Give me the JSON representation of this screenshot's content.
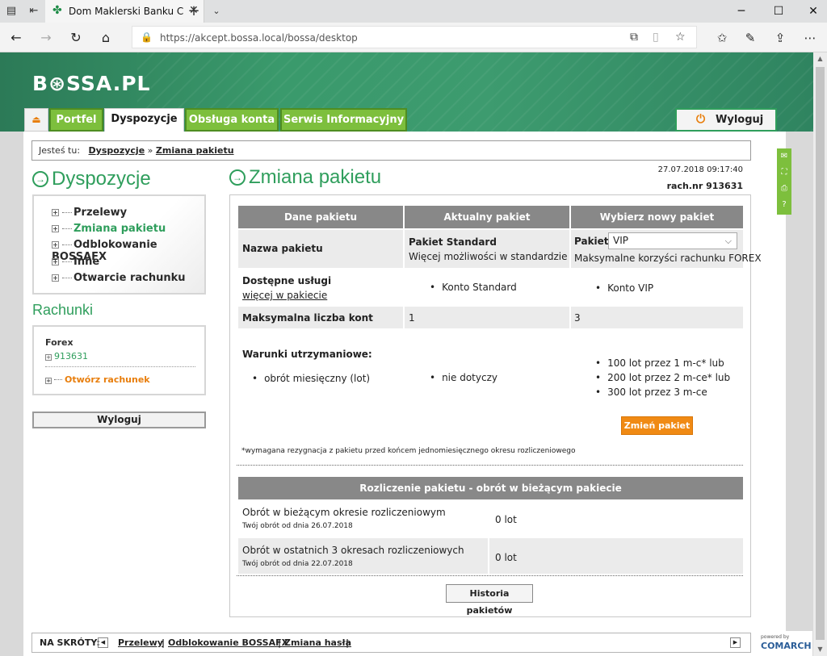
{
  "browser": {
    "tab_title": "Dom Maklerski Banku C",
    "url": "https://akcept.bossa.local/bossa/desktop"
  },
  "header": {
    "logo": "B⊛SSA.PL",
    "nav": [
      "Portfel",
      "Dyspozycje",
      "Obsługa konta",
      "Serwis Informacyjny"
    ],
    "active_nav": "Dyspozycje",
    "logout": "Wyloguj"
  },
  "breadcrumb": {
    "prefix": "Jesteś tu:",
    "items": [
      "Dyspozycje",
      "Zmiana pakietu"
    ],
    "sep": "»"
  },
  "sidebar": {
    "title": "Dyspozycje",
    "items": [
      {
        "label": "Przelewy",
        "active": false
      },
      {
        "label": "Zmiana pakietu",
        "active": true
      },
      {
        "label": "Odblokowanie BOSSAFX",
        "active": false
      },
      {
        "label": "Inne",
        "active": false
      },
      {
        "label": "Otwarcie rachunku",
        "active": false
      }
    ],
    "accounts_title": "Rachunki",
    "account_type": "Forex",
    "account_number": "913631",
    "open_account": "Otwórz rachunek",
    "logout": "Wyloguj"
  },
  "main": {
    "title": "Zmiana pakietu",
    "datetime": "27.07.2018 09:17:40",
    "account": "rach.nr 913631",
    "table": {
      "headers": [
        "Dane pakietu",
        "Aktualny pakiet",
        "Wybierz nowy pakiet"
      ],
      "package_name_label": "Nazwa pakietu",
      "current_name": "Pakiet Standard",
      "current_desc": "Więcej możliwości w standardzie",
      "new_label": "Pakiet",
      "new_selected": "VIP",
      "new_desc": "Maksymalne korzyści rachunku FOREX",
      "services_label": "Dostępne usługi",
      "services_link": "więcej w pakiecie",
      "current_service": "Konto Standard",
      "new_service": "Konto VIP",
      "max_accounts_label": "Maksymalna liczba kont",
      "current_max": "1",
      "new_max": "3",
      "conditions_label": "Warunki utrzymaniowe:",
      "condition_item": "obrót miesięczny (lot)",
      "current_condition": "nie dotyczy",
      "new_conditions": [
        "100 lot przez 1 m-c* lub",
        "200 lot przez 2 m-ce* lub",
        "300 lot przez 3 m-ce"
      ],
      "change_button": "Zmień pakiet",
      "note": "*wymagana rezygnacja z pakietu przed końcem jednomiesięcznego okresu rozliczeniowego"
    },
    "settlement": {
      "header": "Rozliczenie pakietu - obrót w bieżącym pakiecie",
      "rows": [
        {
          "label": "Obrót w bieżącym okresie rozliczeniowym",
          "sub": "Twój obrót od dnia 26.07.2018",
          "value": "0 lot"
        },
        {
          "label": "Obrót w ostatnich 3 okresach rozliczeniowych",
          "sub": "Twój obrót od dnia 22.07.2018",
          "value": "0 lot"
        }
      ],
      "history_button": "Historia pakietów"
    }
  },
  "footer": {
    "label": "NA SKRÓTY:",
    "links": [
      "Przelewy",
      "Odblokowanie BOSSAFX",
      "Zmiana hasła"
    ],
    "sep": "|",
    "powered": "powered by",
    "brand": "COMARCH"
  }
}
